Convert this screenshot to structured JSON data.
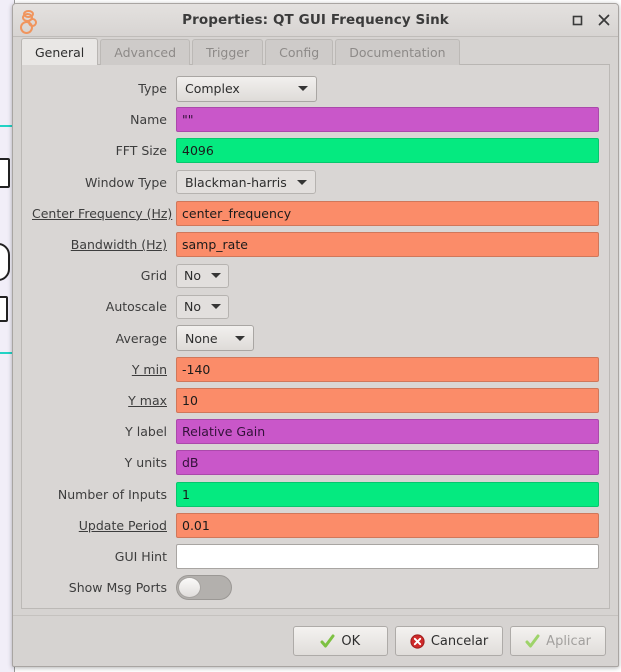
{
  "window": {
    "title": "Properties: QT GUI Frequency Sink",
    "icon": "gnuradio-icon",
    "maximize_icon": "maximize-icon",
    "close_icon": "close-icon"
  },
  "tabs": [
    {
      "label": "General",
      "active": true
    },
    {
      "label": "Advanced",
      "active": false
    },
    {
      "label": "Trigger",
      "active": false
    },
    {
      "label": "Config",
      "active": false
    },
    {
      "label": "Documentation",
      "active": false
    }
  ],
  "fields": [
    {
      "label": "Type",
      "underline": false,
      "kind": "combo",
      "value": "Complex",
      "style": "wide"
    },
    {
      "label": "Name",
      "underline": false,
      "kind": "entry",
      "value": "\"\"",
      "style": "magenta"
    },
    {
      "label": "FFT Size",
      "underline": false,
      "kind": "entry",
      "value": "4096",
      "style": "green"
    },
    {
      "label": "Window Type",
      "underline": false,
      "kind": "combo",
      "value": "Blackman-harris",
      "style": "flat"
    },
    {
      "label": "Center Frequency (Hz)",
      "underline": true,
      "kind": "entry",
      "value": "center_frequency",
      "style": "orange"
    },
    {
      "label": "Bandwidth (Hz)",
      "underline": true,
      "kind": "entry",
      "value": "samp_rate",
      "style": "orange"
    },
    {
      "label": "Grid",
      "underline": false,
      "kind": "combo",
      "value": "No",
      "style": "flat"
    },
    {
      "label": "Autoscale",
      "underline": false,
      "kind": "combo",
      "value": "No",
      "style": "flat"
    },
    {
      "label": "Average",
      "underline": false,
      "kind": "combo",
      "value": "None",
      "style": "raised"
    },
    {
      "label": "Y min",
      "underline": true,
      "kind": "entry",
      "value": "-140",
      "style": "orange"
    },
    {
      "label": "Y max",
      "underline": true,
      "kind": "entry",
      "value": "10",
      "style": "orange"
    },
    {
      "label": "Y label",
      "underline": false,
      "kind": "entry",
      "value": "Relative Gain",
      "style": "magenta"
    },
    {
      "label": "Y units",
      "underline": false,
      "kind": "entry",
      "value": "dB",
      "style": "magenta"
    },
    {
      "label": "Number of Inputs",
      "underline": false,
      "kind": "entry",
      "value": "1",
      "style": "green"
    },
    {
      "label": "Update Period",
      "underline": true,
      "kind": "entry",
      "value": "0.01",
      "style": "orange"
    },
    {
      "label": "GUI Hint",
      "underline": false,
      "kind": "entry",
      "value": "",
      "style": "plain"
    },
    {
      "label": "Show Msg Ports",
      "underline": false,
      "kind": "toggle",
      "value": "off",
      "style": ""
    }
  ],
  "buttons": [
    {
      "label": "OK",
      "icon": "check-icon",
      "disabled": false
    },
    {
      "label": "Cancelar",
      "icon": "cancel-icon",
      "disabled": false
    },
    {
      "label": "Aplicar",
      "icon": "check-icon",
      "disabled": true
    }
  ],
  "colors": {
    "orange": "#fb8c69",
    "green": "#05ea80",
    "magenta": "#c957c9",
    "dialog": "#d6d3d1",
    "wire": "#22d3c5"
  }
}
